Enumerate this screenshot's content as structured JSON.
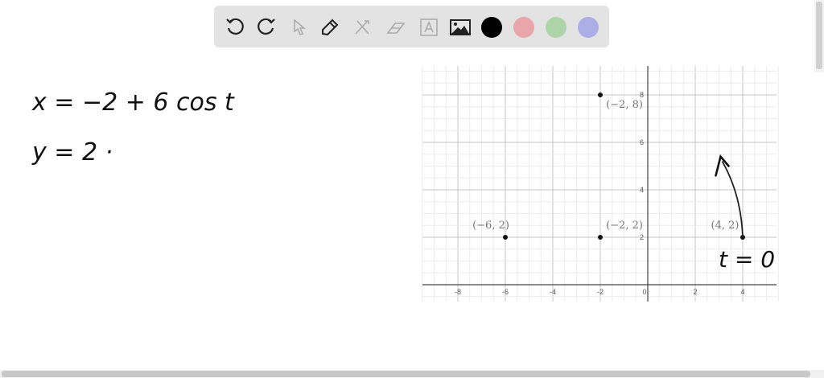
{
  "toolbar": {
    "tools": [
      "undo-icon",
      "redo-icon",
      "select-icon",
      "pen-icon",
      "tools-icon",
      "eraser-icon",
      "text-icon",
      "image-icon"
    ],
    "colors": {
      "black": "#000000",
      "red": "#e8a5aa",
      "green": "#acd4a8",
      "blue": "#acaee6"
    }
  },
  "notes": {
    "line1": "x = −2 + 6 cos t",
    "line2": "y = 2 ·",
    "annotation": "t = 0"
  },
  "chart_data": {
    "type": "scatter",
    "xlim": [
      -9.5,
      5.5
    ],
    "ylim": [
      -0.7,
      9.3
    ],
    "grid": true,
    "x_ticks": [
      "-8",
      "-6",
      "-4",
      "-2",
      "0",
      "2",
      "4"
    ],
    "y_ticks": [
      "2",
      "4",
      "6",
      "8"
    ],
    "points": [
      {
        "x": -2,
        "y": 8,
        "label": "(−2, 8)"
      },
      {
        "x": -6,
        "y": 2,
        "label": "(−6, 2)"
      },
      {
        "x": -2,
        "y": 2,
        "label": "(−2, 2)"
      },
      {
        "x": 4,
        "y": 2,
        "label": "(4, 2)"
      }
    ]
  }
}
